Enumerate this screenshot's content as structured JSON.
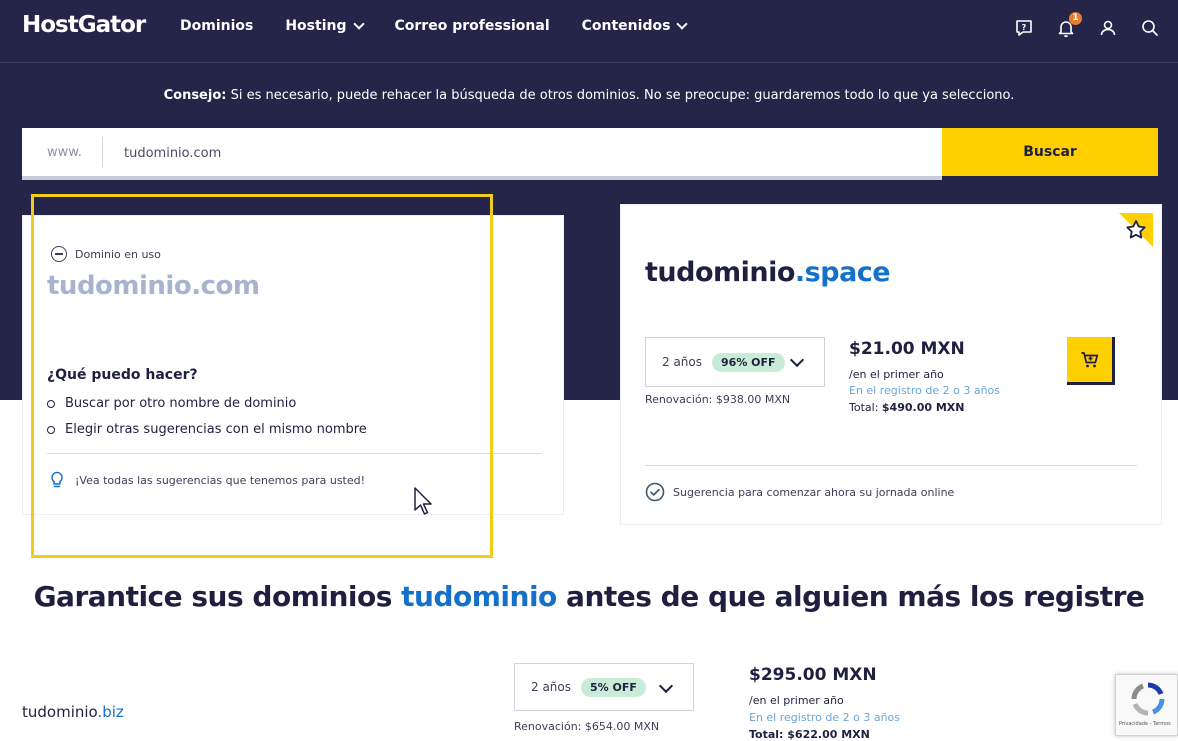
{
  "header": {
    "logo": "HostGator",
    "nav": [
      {
        "label": "Dominios",
        "dropdown": false
      },
      {
        "label": "Hosting",
        "dropdown": true
      },
      {
        "label": "Correo professional",
        "dropdown": false
      },
      {
        "label": "Contenidos",
        "dropdown": true
      }
    ],
    "notification_count": "1"
  },
  "tip": {
    "label": "Consejo:",
    "text": " Si es necesario, puede rehacer la búsqueda de otros dominios. No se preocupe: guardaremos todo lo que ya selecciono."
  },
  "search": {
    "prefix": "www.",
    "value": "tudominio.com",
    "button": "Buscar"
  },
  "unavailable_card": {
    "status": "Dominio en uso",
    "domain": "tudominio.com",
    "what_title": "¿Qué puedo hacer?",
    "options": [
      "Buscar por otro nombre de dominio",
      "Elegir otras sugerencias con el mismo nombre"
    ],
    "all_suggestions": "¡Vea todas las sugerencias que tenemos para usted!"
  },
  "suggested_card": {
    "domain_name": "tudominio",
    "domain_ext": ".space",
    "years": "2 años",
    "discount": "96% OFF",
    "renewal": "Renovación: $938.00 MXN",
    "price": "$21.00 MXN",
    "first_year": "/en el primer año",
    "registration_note": "En el registro de 2 o 3 años",
    "total_label": "Total: ",
    "total_value": "$490.00 MXN",
    "suggestion_text": "Sugerencia para comenzar ahora su jornada online"
  },
  "section": {
    "heading_pre": "Garantice sus dominios ",
    "heading_highlight": "tudominio",
    "heading_post": " antes de que alguien más los registre"
  },
  "row2": {
    "domain_name": "tudominio",
    "domain_ext": ".biz",
    "years": "2 años",
    "discount": "5% OFF",
    "renewal": "Renovación: $654.00 MXN",
    "price": "$295.00 MXN",
    "first_year": "/en el primer año",
    "registration_note": "En el registro de 2 o 3 años",
    "total": "Total: $622.00 MXN"
  },
  "recaptcha": {
    "text": "Privacidade - Termos"
  },
  "colors": {
    "dark_band": "#25254a",
    "accent_yellow": "#ffcf00",
    "link_blue": "#1470c9",
    "discount_green": "#c9ecd9"
  }
}
